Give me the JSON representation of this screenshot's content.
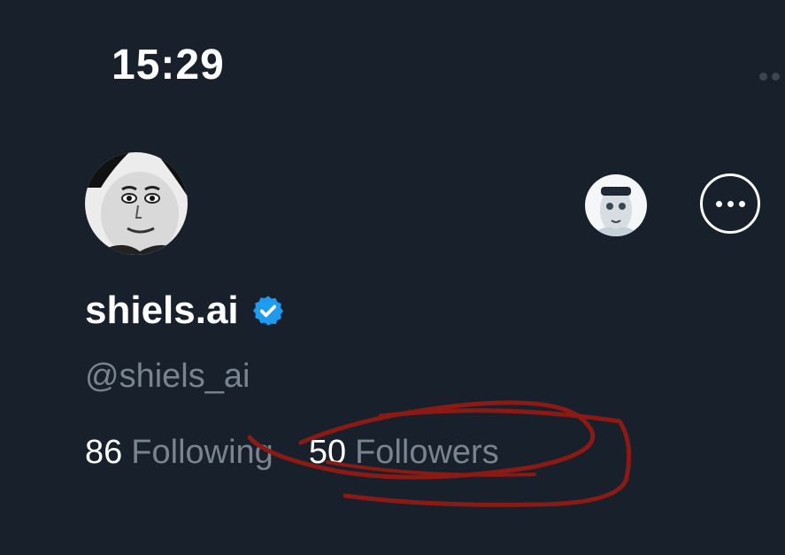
{
  "status_bar": {
    "time": "15:29"
  },
  "header": {
    "more_icon": "more-horizontal-icon"
  },
  "profile": {
    "display_name": "shiels.ai",
    "verified": true,
    "verified_color": "#1d9bf0",
    "handle": "@shiels_ai",
    "following_count": "86",
    "following_label": "Following",
    "followers_count": "50",
    "followers_label": "Followers"
  },
  "annotation": {
    "type": "hand-drawn circle around followers",
    "color": "#8b1a14"
  },
  "colors": {
    "background": "#17202b",
    "primary_text": "#ffffff",
    "secondary_text": "#78848f"
  }
}
